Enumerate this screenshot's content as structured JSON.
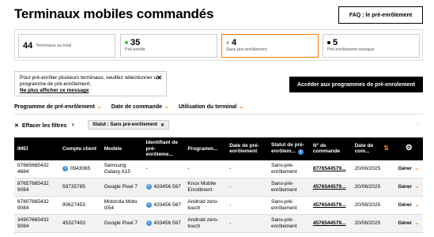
{
  "page_title": "Terminaux mobiles commandés",
  "faq_button": "FAQ : le pré-enrôlement",
  "summary": [
    {
      "num": "44",
      "label": "Terminaux au total",
      "dot": ""
    },
    {
      "num": "35",
      "label": "Pré-enrôlé",
      "dot": "#32c832"
    },
    {
      "num": "4",
      "label": "Sans pré-enrôlement",
      "dot": "#bbbbbb"
    },
    {
      "num": "5",
      "label": "Pré-enrôlement révoqué",
      "dot": "#000000"
    }
  ],
  "notice": {
    "text": "Pour pré-enrôler plusieurs terminaux, veuillez sélectionner un programme de pré-enrôlement.",
    "link": "Ne plus afficher ce message"
  },
  "access_button": "Accéder aux programmes de pré-enrolement",
  "filters": [
    "Programme de pré-enrôlement",
    "Date de commande",
    "Utilisation du terminal"
  ],
  "clear_filters": "Effacer les filtres",
  "chip": "Statut : Sans pré-enrôlement",
  "table": {
    "headers": [
      "IMEI",
      "Compte client",
      "Modèle",
      "Identifiant de pré-enrôleme...",
      "Programm...",
      "Date de pré-enrôlement",
      "Statut de pré-enrôlem...",
      "N° de commande",
      "Date de com...",
      "",
      ""
    ],
    "rows": [
      {
        "imei": "97665665432 4684",
        "account": "0943065",
        "account_info": true,
        "model": "Samsung Galaxy A15",
        "ident": "-",
        "ident_info": false,
        "program": "-",
        "date_pre": "-",
        "status": "Sans-pré-enrôlement",
        "order": "8776544579...",
        "date_cmd": "20/08/2025",
        "manage": "Gérer"
      },
      {
        "imei": "87657665432 9084",
        "account": "59735785",
        "account_info": false,
        "model": "Google Pixel 7",
        "ident": "433456 567",
        "ident_info": true,
        "program": "Knox Mobile Enrollment",
        "date_pre": "-",
        "status": "Sans-pré-enrôlement",
        "order": "4576544579...",
        "date_cmd": "20/08/2025",
        "manage": "Gérer"
      },
      {
        "imei": "67807665432 9084",
        "account": "90627453",
        "account_info": false,
        "model": "Motorola Moto G54",
        "ident": "433456 567",
        "ident_info": true,
        "program": "Android zero-touch",
        "date_pre": "-",
        "status": "Sans-pré-enrôlement",
        "order": "4576544579...",
        "date_cmd": "20/08/2025",
        "manage": "Gérer"
      },
      {
        "imei": "34907665432 9084",
        "account": "45327403",
        "account_info": false,
        "model": "Google Pixel 7",
        "ident": "433456 567",
        "ident_info": true,
        "program": "Android zero-touch",
        "date_pre": "-",
        "status": "Sans-pré-enrôlement",
        "order": "4576544579...",
        "date_cmd": "20/08/2025",
        "manage": "Gérer"
      }
    ]
  }
}
